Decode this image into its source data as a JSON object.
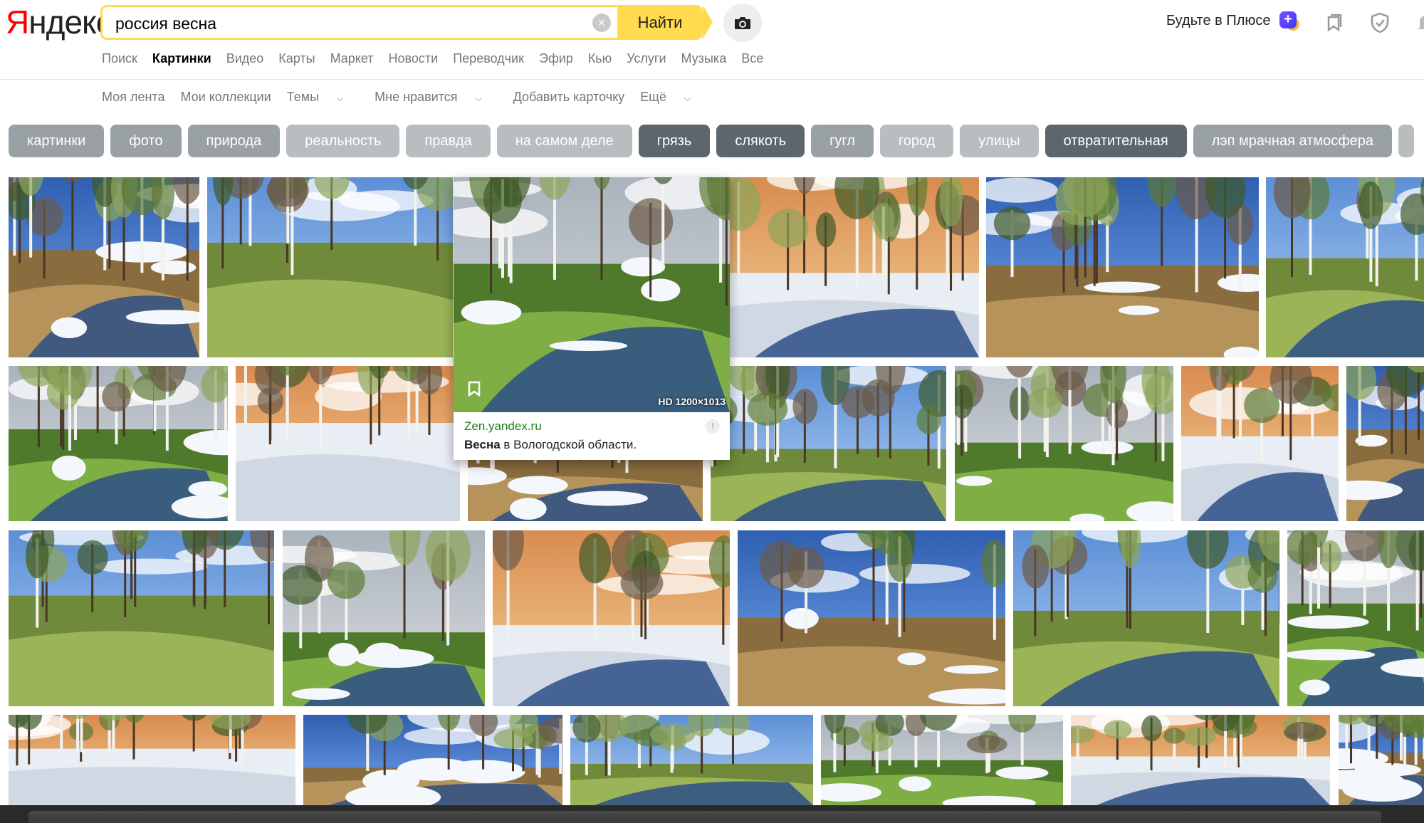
{
  "logo": {
    "first": "Я",
    "rest": "ндекс"
  },
  "search": {
    "value": "россия весна",
    "button": "Найти"
  },
  "header": {
    "plus_label": "Будьте в Плюсе"
  },
  "tabs": [
    "Поиск",
    "Картинки",
    "Видео",
    "Карты",
    "Маркет",
    "Новости",
    "Переводчик",
    "Эфир",
    "Кью",
    "Услуги",
    "Музыка",
    "Все"
  ],
  "active_tab": "Картинки",
  "subnav": {
    "feed": "Моя лента",
    "collections": "Мои коллекции",
    "themes": "Темы",
    "likes": "Мне нравится",
    "add_card": "Добавить карточку",
    "more": "Ещё"
  },
  "chips": [
    "картинки",
    "фото",
    "природа",
    "реальность",
    "правда",
    "на самом деле",
    "грязь",
    "слякоть",
    "гугл",
    "город",
    "улицы",
    "отвратительная",
    "лэп мрачная атмосфера"
  ],
  "chip_styles": [
    "mid",
    "mid",
    "mid",
    "light",
    "light",
    "light",
    "dark",
    "dark",
    "mid",
    "light",
    "light",
    "dark",
    "mid"
  ],
  "popup": {
    "resolution": "HD 1200×1013",
    "source": "Zen.yandex.ru",
    "title_bold": "Весна",
    "title_rest": " в Вологодской области.",
    "info": "!"
  },
  "colors": {
    "accent": "#ffdb4d",
    "logo_red": "#ff0000",
    "source_green": "#1a7f1a"
  },
  "images": [
    {
      "scene": "birch-floods-blue-sky"
    },
    {
      "scene": "pine-forest-river-snow"
    },
    {
      "scene": "forest-stream-snow"
    },
    {
      "scene": "birch-grove-purple-flowers"
    },
    {
      "scene": "birch-snow-melting"
    },
    {
      "scene": "sunset-lake-cotton-grass"
    },
    {
      "scene": "trees-flood-sunset"
    },
    {
      "scene": "green-trees-sunshine"
    },
    {
      "scene": "forest-stream-snow-patches"
    },
    {
      "scene": "stream-green-valley"
    },
    {
      "scene": "birch-flooded-forest"
    },
    {
      "scene": "birch-water-reflection"
    },
    {
      "scene": "pine-coast"
    },
    {
      "scene": "scilla-flowers-forest"
    },
    {
      "scene": "birch-pine-ice"
    },
    {
      "scene": "river-meadow-snow"
    },
    {
      "scene": "birch-marsh"
    },
    {
      "scene": "clouds-river-meadow"
    },
    {
      "scene": "birch-snow-path"
    },
    {
      "scene": "forest-stream-autumn"
    },
    {
      "scene": "birch-blue-sky"
    },
    {
      "scene": "river-pine-forest"
    },
    {
      "scene": "trees-clouds-field"
    },
    {
      "scene": "sunset-dark-field"
    },
    {
      "scene": "pine-tops"
    }
  ]
}
